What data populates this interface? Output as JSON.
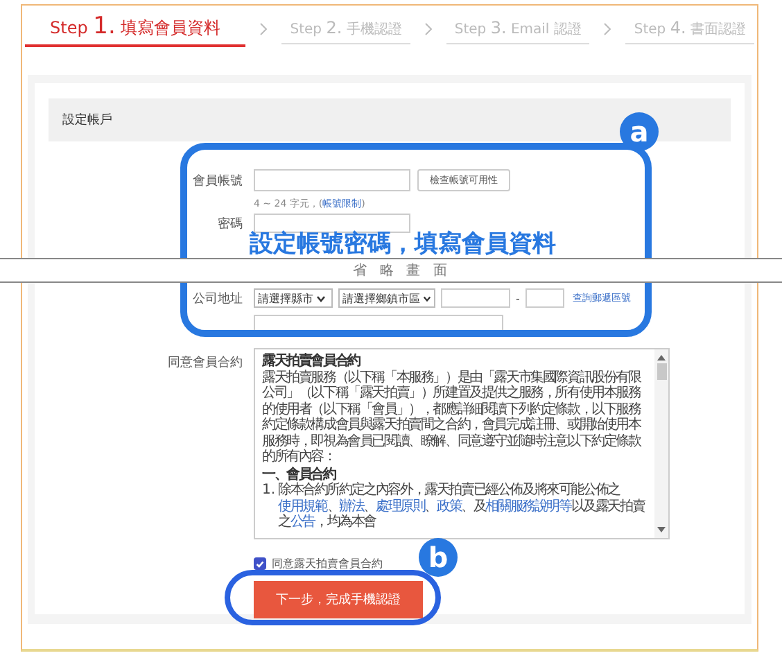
{
  "steps": [
    {
      "prefix": "Step",
      "number": "1.",
      "label": "填寫會員資料",
      "selected": true
    },
    {
      "prefix": "Step",
      "number": "2.",
      "label": "手機認證",
      "selected": false
    },
    {
      "prefix": "Step",
      "number": "3.",
      "label": "Email 認證",
      "selected": false
    },
    {
      "prefix": "Step",
      "number": "4.",
      "label": "書面認證",
      "selected": false
    }
  ],
  "section_title": "設定帳戶",
  "account": {
    "label": "會員帳號",
    "check_button": "檢查帳號可用性",
    "hint_before": "4 ~ 24 字元，(",
    "hint_link": "帳號限制",
    "hint_after": ")"
  },
  "password": {
    "label": "密碼"
  },
  "address": {
    "label": "公司地址",
    "city_select": "請選擇縣市",
    "district_select": "請選擇鄉鎮市區",
    "separator": "-",
    "lookup_link": "查詢郵遞區號"
  },
  "agreement": {
    "label": "同意會員合約",
    "title": "露天拍賣會員合約",
    "intro": "露天拍賣服務（以下稱「本服務」）是由「露天市集國際資訊股份有限公司」（以下稱「露天拍賣」）所建置及提供之服務，所有使用本服務的使用者（以下稱「會員」），都應詳細閱讀下列約定條款，以下服務約定條款構成會員與露天拍賣間之合約，會員完成註冊、或開始使用本服務時，即視為會員已閱讀、瞭解、同意遵守並隨時注意以下約定條款的所有內容：",
    "section": "一、會員合約",
    "clause_number": "1.",
    "clause": [
      {
        "kind": "text",
        "text": "除本合約所約定之內容外，露天拍賣已經公佈及將來可能公佈之"
      },
      {
        "kind": "link",
        "text": "使用規範"
      },
      {
        "kind": "text",
        "text": "、"
      },
      {
        "kind": "link",
        "text": "辦法"
      },
      {
        "kind": "text",
        "text": "、"
      },
      {
        "kind": "link",
        "text": "處理原則"
      },
      {
        "kind": "text",
        "text": "、"
      },
      {
        "kind": "link",
        "text": "政策"
      },
      {
        "kind": "text",
        "text": "、及"
      },
      {
        "kind": "link",
        "text": "相關服務說明等"
      },
      {
        "kind": "text",
        "text": "以及露天拍賣之"
      },
      {
        "kind": "link",
        "text": "公告"
      },
      {
        "kind": "text",
        "text": "，均為本會"
      }
    ]
  },
  "consent": {
    "label": "同意露天拍賣會員合約",
    "checked": true
  },
  "submit": "下一步，完成手機認證",
  "annotations": {
    "badge_a": "a",
    "caption": "設定帳號密碼，填寫會員資料",
    "omitted": "省 略 畫 面",
    "badge_b": "b"
  }
}
